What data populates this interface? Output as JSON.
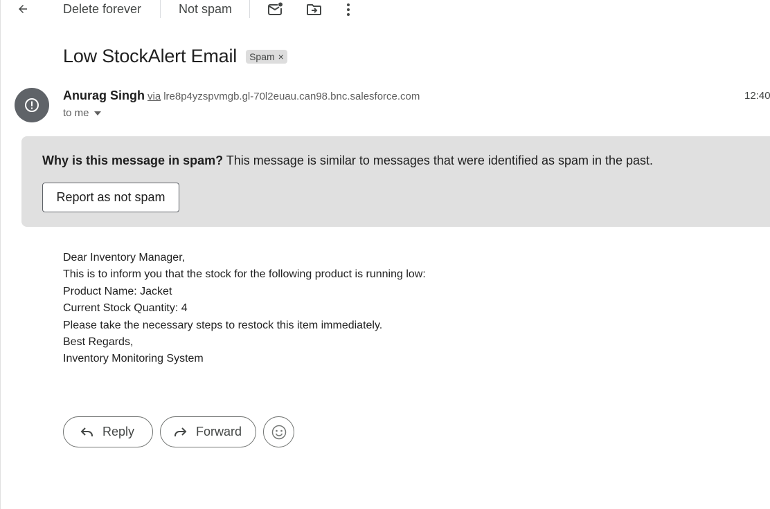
{
  "toolbar": {
    "back_icon": "arrow-left-icon",
    "delete_forever": "Delete forever",
    "not_spam": "Not spam",
    "mark_unread_icon": "mail-unread-icon",
    "move_to_icon": "move-to-folder-icon",
    "more_icon": "more-vert-icon"
  },
  "email": {
    "subject": "Low StockAlert Email",
    "label": "Spam",
    "label_remove": "×",
    "sender_name": "Anurag Singh",
    "via": "via",
    "via_address": "lre8p4yzspvmgb.gl-70l2euau.can98.bnc.salesforce.com",
    "time": "12:40",
    "to": "to me",
    "avatar_icon": "alert-circle-icon"
  },
  "spam_banner": {
    "question": "Why is this message in spam?",
    "explanation": "This message is similar to messages that were identified as spam in the past.",
    "report_button": "Report as not spam"
  },
  "body_lines": {
    "l0": "Dear Inventory Manager,",
    "l1": "This is to inform you that the stock for the following product is running low:",
    "l2": "Product Name: Jacket",
    "l3": "Current Stock Quantity: 4",
    "l4": "Please take the necessary steps to restock this item immediately.",
    "l5": "Best Regards,",
    "l6": "Inventory Monitoring System"
  },
  "actions": {
    "reply": "Reply",
    "forward": "Forward",
    "emoji_icon": "smiley-icon"
  },
  "colors": {
    "banner_bg": "#e0e0e0",
    "avatar_bg": "#5f6368",
    "text_primary": "#1f1f1f",
    "text_secondary": "#444746"
  }
}
